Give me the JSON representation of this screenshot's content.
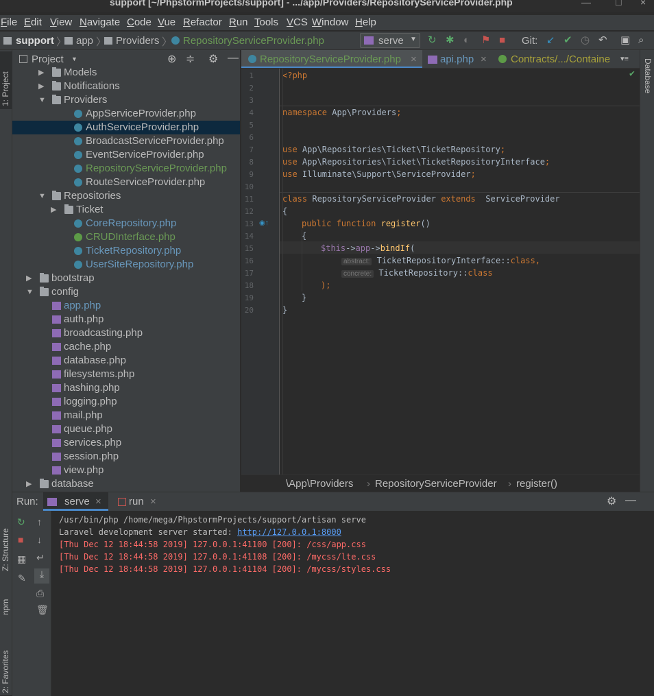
{
  "window": {
    "title": "support [~/PhpstormProjects/support] - .../app/Providers/RepositoryServiceProvider.php",
    "min_glyph": "—",
    "max_glyph": "□",
    "close_glyph": "×"
  },
  "menu": [
    "File",
    "Edit",
    "View",
    "Navigate",
    "Code",
    "Vue",
    "Refactor",
    "Run",
    "Tools",
    "VCS",
    "Window",
    "Help"
  ],
  "navbar": {
    "crumbs": [
      "support",
      "app",
      "Providers",
      "RepositoryServiceProvider.php"
    ],
    "run_config": "serve",
    "git_label": "Git:"
  },
  "side_tabs": {
    "project": "1: Project",
    "structure": "Z: Structure",
    "npm": "npm",
    "favorites": "2: Favorites",
    "database": "Database"
  },
  "project": {
    "title": "Project",
    "tree": [
      {
        "label": "Models",
        "type": "folder",
        "depth": 2,
        "arrow": "▶"
      },
      {
        "label": "Notifications",
        "type": "folder",
        "depth": 2,
        "arrow": "▶"
      },
      {
        "label": "Providers",
        "type": "folder",
        "depth": 2,
        "arrow": "▼"
      },
      {
        "label": "AppServiceProvider.php",
        "type": "class",
        "depth": 3
      },
      {
        "label": "AuthServiceProvider.php",
        "type": "class",
        "depth": 3,
        "selected": true
      },
      {
        "label": "BroadcastServiceProvider.php",
        "type": "class",
        "depth": 3
      },
      {
        "label": "EventServiceProvider.php",
        "type": "class",
        "depth": 3
      },
      {
        "label": "RepositoryServiceProvider.php",
        "type": "class",
        "depth": 3,
        "color": "#6a9955"
      },
      {
        "label": "RouteServiceProvider.php",
        "type": "class",
        "depth": 3
      },
      {
        "label": "Repositories",
        "type": "folder",
        "depth": 2,
        "arrow": "▼"
      },
      {
        "label": "Ticket",
        "type": "folder",
        "depth": 3,
        "arrow": "▶"
      },
      {
        "label": "CoreRepository.php",
        "type": "class",
        "depth": 3,
        "color": "#6897bb"
      },
      {
        "label": "CRUDInterface.php",
        "type": "interface",
        "depth": 3,
        "color": "#6a9955"
      },
      {
        "label": "TicketRepository.php",
        "type": "class",
        "depth": 3,
        "color": "#6897bb"
      },
      {
        "label": "UserSiteRepository.php",
        "type": "class",
        "depth": 3,
        "color": "#6897bb"
      },
      {
        "label": "bootstrap",
        "type": "folder",
        "depth": 1,
        "arrow": "▶"
      },
      {
        "label": "config",
        "type": "folder",
        "depth": 1,
        "arrow": "▼"
      },
      {
        "label": "app.php",
        "type": "php",
        "depth": 2,
        "color": "#6897bb"
      },
      {
        "label": "auth.php",
        "type": "php",
        "depth": 2
      },
      {
        "label": "broadcasting.php",
        "type": "php",
        "depth": 2
      },
      {
        "label": "cache.php",
        "type": "php",
        "depth": 2
      },
      {
        "label": "database.php",
        "type": "php",
        "depth": 2
      },
      {
        "label": "filesystems.php",
        "type": "php",
        "depth": 2
      },
      {
        "label": "hashing.php",
        "type": "php",
        "depth": 2
      },
      {
        "label": "logging.php",
        "type": "php",
        "depth": 2
      },
      {
        "label": "mail.php",
        "type": "php",
        "depth": 2
      },
      {
        "label": "queue.php",
        "type": "php",
        "depth": 2
      },
      {
        "label": "services.php",
        "type": "php",
        "depth": 2
      },
      {
        "label": "session.php",
        "type": "php",
        "depth": 2
      },
      {
        "label": "view.php",
        "type": "php",
        "depth": 2
      },
      {
        "label": "database",
        "type": "folder",
        "depth": 1,
        "arrow": "▶"
      }
    ]
  },
  "tabs": [
    {
      "label": "RepositoryServiceProvider.php",
      "color": "#6a9955",
      "icon": "C",
      "active": true
    },
    {
      "label": "api.php",
      "color": "#6897bb",
      "icon": "PHP"
    },
    {
      "label": "Contracts/.../Containe",
      "color": "#a6a03a",
      "icon": "I"
    }
  ],
  "code": {
    "line_numbers": [
      "1",
      "2",
      "3",
      "4",
      "5",
      "6",
      "7",
      "8",
      "9",
      "10",
      "11",
      "12",
      "13",
      "14",
      "15",
      "16",
      "17",
      "18",
      "19",
      "20"
    ],
    "l1": "<?php",
    "l4a": "namespace",
    "l4b": " App\\Providers",
    ";": ";",
    "use": "use",
    "l7": " App\\Repositories\\Ticket\\TicketRepository",
    "l8": " App\\Repositories\\Ticket\\TicketRepositoryInterface",
    "l9": " Illuminate\\Support\\ServiceProvider",
    "l11a": "class",
    "l11b": " RepositoryServiceProvider ",
    "l11c": "extends",
    "l11d": "  ServiceProvider",
    "lbrace": "{",
    "rbrace": "}",
    "l13a": "public function ",
    "l13b": "register",
    "l13c": "()",
    "l15a": "$this",
    "l15b": "->",
    "l15c": "app",
    "l15d": "->",
    "l15e": "bindIf",
    "l15f": "(",
    "hint1": "abstract:",
    "l16a": "TicketRepositoryInterface",
    "l16b": "::",
    "l16c": "class",
    ",": ",",
    "hint2": "concrete:",
    "l17a": "TicketRepository",
    "l17b": "::",
    "l17c": "class",
    "l18": ");"
  },
  "editor_breadcrumb": [
    "\\App\\Providers",
    "RepositoryServiceProvider",
    "register()"
  ],
  "run": {
    "label": "Run:",
    "tabs": [
      "serve",
      "run"
    ],
    "console": [
      {
        "text": "/usr/bin/php /home/mega/PhpstormProjects/support/artisan serve",
        "color": "#bbbbbb"
      },
      {
        "text": "Laravel development server started: ",
        "color": "#bbbbbb",
        "link": "http://127.0.0.1:8000"
      },
      {
        "text": "[Thu Dec 12 18:44:58 2019] 127.0.0.1:41100 [200]: /css/app.css",
        "color": "#ff6b68"
      },
      {
        "text": "[Thu Dec 12 18:44:58 2019] 127.0.0.1:41108 [200]: /mycss/lte.css",
        "color": "#ff6b68"
      },
      {
        "text": "[Thu Dec 12 18:44:58 2019] 127.0.0.1:41104 [200]: /mycss/styles.css",
        "color": "#ff6b68"
      }
    ]
  }
}
